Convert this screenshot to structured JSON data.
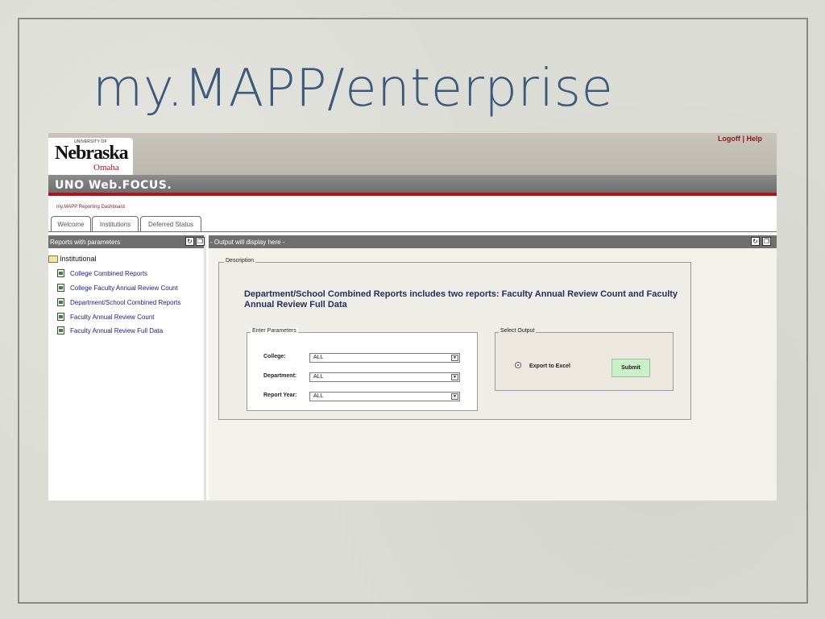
{
  "slide": {
    "title": "my.MAPP/enterprise"
  },
  "brand": {
    "univ": "UNIVERSITY OF",
    "name": "Nebraska",
    "sub": "Omaha"
  },
  "top_links": {
    "logoff": "Logoff",
    "separator": "|",
    "help": "Help"
  },
  "header": {
    "title": "UNO Web.FOCUS."
  },
  "dashboard_label": "my.MAPP Reporting Dashboard",
  "tabs": [
    {
      "label": "Welcome"
    },
    {
      "label": "Institutions"
    },
    {
      "label": "Deferred Status"
    }
  ],
  "left_panel": {
    "header": "Reports with parameters",
    "refresh_icon": "refresh-icon",
    "restore_icon": "restore-icon",
    "folder": "Institutional",
    "items": [
      {
        "label": "College Combined Reports"
      },
      {
        "label": "College Faculty Annual Review Count"
      },
      {
        "label": "Department/School Combined Reports"
      },
      {
        "label": "Faculty Annual Review Count"
      },
      {
        "label": "Faculty Annual Review Full Data"
      }
    ]
  },
  "right_panel": {
    "header": "- Output will display here -",
    "description_legend": "Description",
    "description_text": "Department/School Combined Reports includes two reports:  Faculty Annual Review Count and Faculty Annual Review Full Data",
    "params_legend": "Enter Parameters",
    "params": [
      {
        "label": "College:",
        "value": "ALL"
      },
      {
        "label": "Department:",
        "value": "ALL"
      },
      {
        "label": "Report Year:",
        "value": "ALL"
      }
    ],
    "output_legend": "Select Output",
    "output_option": "Export to Excel",
    "submit_label": "Submit"
  },
  "colors": {
    "title_blue": "#3d5a7a",
    "brand_red": "#b3121c",
    "submit_green": "#c9f0c9"
  }
}
